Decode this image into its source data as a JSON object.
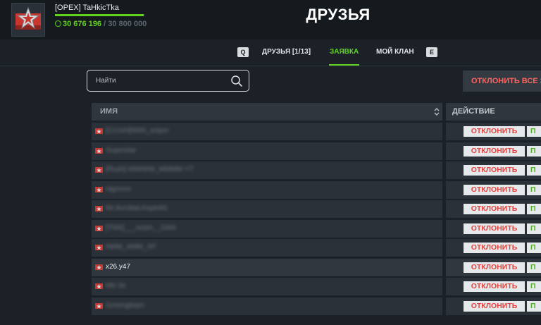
{
  "header": {
    "player_name": "[OPEX] TaHkicTka",
    "xp_current": "30 676 196",
    "xp_separator": "/",
    "xp_max": "30 800 000",
    "xp_progress": 0.996,
    "page_title": "ДРУЗЬЯ"
  },
  "tabs": {
    "prev_key": "Q",
    "friends_label": "ДРУЗЬЯ [1/13]",
    "requests_label": "ЗАЯВКА",
    "clan_label": "МОЙ КЛАН",
    "next_key": "E",
    "active": "ЗАЯВКА"
  },
  "search": {
    "placeholder": "Найти",
    "value": ""
  },
  "reject_all_label": "ОТКЛОНИТЬ ВСЕ З",
  "table": {
    "col_name": "ИМЯ",
    "col_action": "ДЕЙСТВИЕ",
    "reject_label": "ОТКЛОНИТЬ",
    "accept_label": "П",
    "rows": [
      {
        "name": "[CrUsH]NNN_sniper",
        "blurred": true
      },
      {
        "name": "Superstar",
        "blurred": true
      },
      {
        "name": "[Rush]-WWWW_MMMM-YT",
        "blurred": true
      },
      {
        "name": "nigmore",
        "blurred": true
      },
      {
        "name": "Mr.Acrobat.Keptn91",
        "blurred": true
      },
      {
        "name": "[TNN]___resim__DAN",
        "blurred": true
      },
      {
        "name": "NMM_AMM_XP",
        "blurred": true
      },
      {
        "name": "x26.y47",
        "blurred": false
      },
      {
        "name": "Mtr-3s",
        "blurred": true
      },
      {
        "name": "Greengleam",
        "blurred": true
      }
    ]
  },
  "colors": {
    "accent_green": "#64d424",
    "reject_red": "#e4433f",
    "background": "#1b2127"
  }
}
